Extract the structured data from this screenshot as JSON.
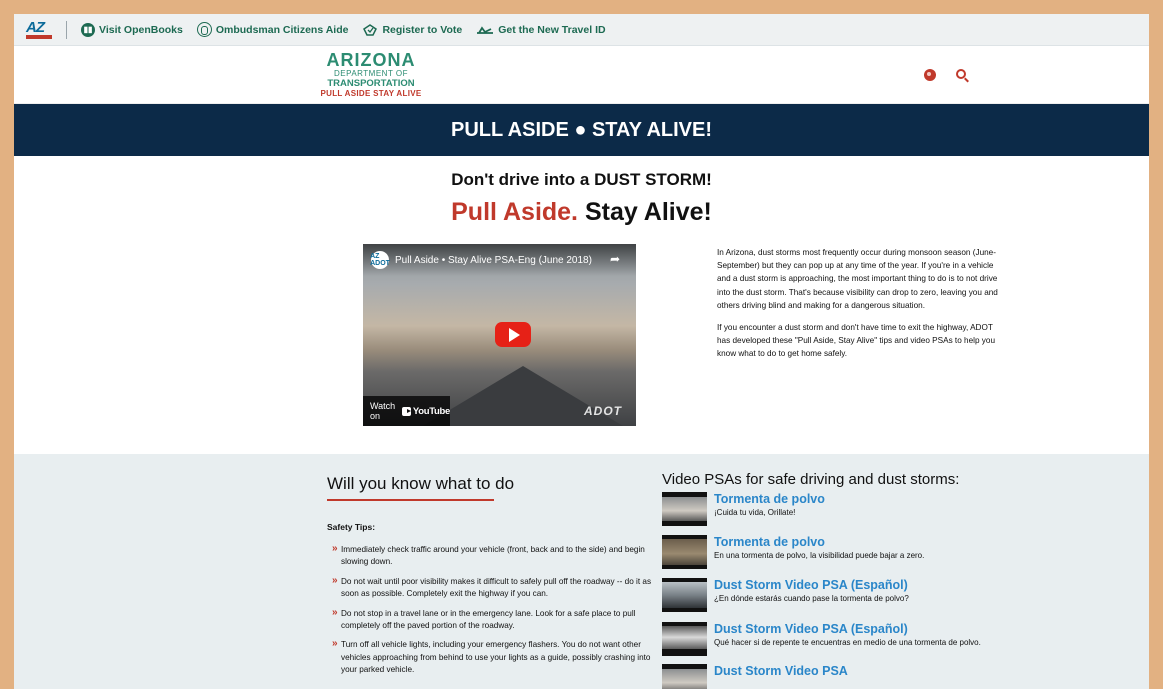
{
  "topbar": {
    "logo_text": "AZ",
    "links": [
      {
        "label": "Visit OpenBooks",
        "icon": "book-icon"
      },
      {
        "label": "Ombudsman Citizens Aide",
        "icon": "person-icon"
      },
      {
        "label": "Register to Vote",
        "icon": "ballot-icon"
      },
      {
        "label": "Get the New Travel ID",
        "icon": "plane-icon"
      }
    ]
  },
  "brand": {
    "line1": "ARIZONA",
    "line2": "DEPARTMENT OF",
    "line3": "TRANSPORTATION",
    "line4": "PULL ASIDE STAY ALIVE"
  },
  "banner": {
    "title": "PULL ASIDE ● STAY ALIVE!"
  },
  "intro": {
    "subtitle": "Don't drive into a DUST STORM!",
    "headline_red": "Pull Aside.",
    "headline_dark": "Stay Alive!"
  },
  "video": {
    "channel_badge": "AZ ADOT",
    "title": "Pull Aside • Stay Alive PSA-Eng (June 2018)",
    "watch_label": "Watch on",
    "youtube_label": "YouTube",
    "watermark": "ADOT"
  },
  "description": {
    "p1": "In Arizona, dust storms most frequently occur during monsoon season (June-September) but they can pop up at any time of the year. If you're in a vehicle and a dust storm is approaching, the most important thing to do is to not drive into the dust storm. That's because visibility can drop to zero, leaving you and others driving blind and making for a dangerous situation.",
    "p2": "If you encounter a dust storm and don't have time to exit the highway, ADOT has developed these \"Pull Aside, Stay Alive\" tips and video PSAs to help you know what to do to get home safely."
  },
  "know": {
    "title": "Will you know what to do",
    "safety_label": "Safety Tips:",
    "tips": [
      "Immediately check traffic around your vehicle (front, back and to the side) and begin slowing down.",
      "Do not wait until poor visibility makes it difficult to safely pull off the roadway -- do it as soon as possible. Completely exit the highway if you can.",
      "Do not stop in a travel lane or in the emergency lane. Look for a safe place to pull completely off the paved portion of the roadway.",
      "Turn off all vehicle lights, including your emergency flashers. You do not want other vehicles approaching from behind to use your lights as a guide, possibly crashing into your parked vehicle."
    ]
  },
  "psas": {
    "title": "Video PSAs for safe driving and dust storms:",
    "items": [
      {
        "name": "Tormenta de polvo",
        "desc": "¡Cuida tu vida, Orillate!"
      },
      {
        "name": "Tormenta de polvo",
        "desc": "En una tormenta de polvo, la visibilidad puede bajar a zero."
      },
      {
        "name": "Dust Storm Video PSA (Español)",
        "desc": "¿En dónde estarás cuando pase la tormenta de polvo?"
      },
      {
        "name": "Dust Storm Video PSA (Español)",
        "desc": "Qué hacer si de repente te encuentras en medio de una tormenta de polvo."
      },
      {
        "name": "Dust Storm Video PSA",
        "desc": ""
      }
    ]
  },
  "colors": {
    "navy": "#0c2a48",
    "red": "#c0392b",
    "green": "#1d6a52",
    "link_blue": "#2a86c9",
    "page_border": "#e2b182"
  }
}
